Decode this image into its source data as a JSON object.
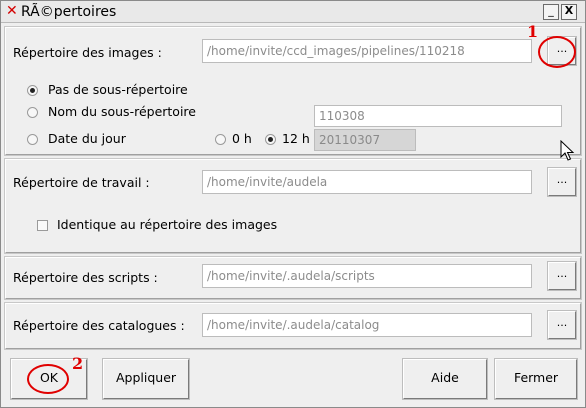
{
  "window": {
    "title": "RÃ©pertoires",
    "minimize_label": "_",
    "close_label": "X"
  },
  "images": {
    "label": "Répertoire des images :",
    "path": "/home/invite/ccd_images/pipelines/110218",
    "browse_label": "...",
    "annotation": "1",
    "options": {
      "none_label": "Pas de sous-répertoire",
      "name_label": "Nom du sous-répertoire",
      "name_value": "110308",
      "date_label": "Date du jour",
      "hour0_label": "0 h",
      "hour12_label": "12 h",
      "date_value": "20110307",
      "selected": "none",
      "hour_selected": "12h"
    }
  },
  "work": {
    "label": "Répertoire de travail :",
    "path": "/home/invite/audela",
    "browse_label": "...",
    "same_label": "Identique au répertoire des images"
  },
  "scripts": {
    "label": "Répertoire des scripts :",
    "path": "/home/invite/.audela/scripts",
    "browse_label": "..."
  },
  "catalogs": {
    "label": "Répertoire des catalogues :",
    "path": "/home/invite/.audela/catalog",
    "browse_label": "..."
  },
  "buttons": {
    "ok_label": "OK",
    "ok_annotation": "2",
    "apply_label": "Appliquer",
    "help_label": "Aide",
    "close_label": "Fermer"
  },
  "colors": {
    "annotation_red": "#e00000",
    "title_icon_red": "#d40000",
    "window_bg": "#efefef"
  }
}
